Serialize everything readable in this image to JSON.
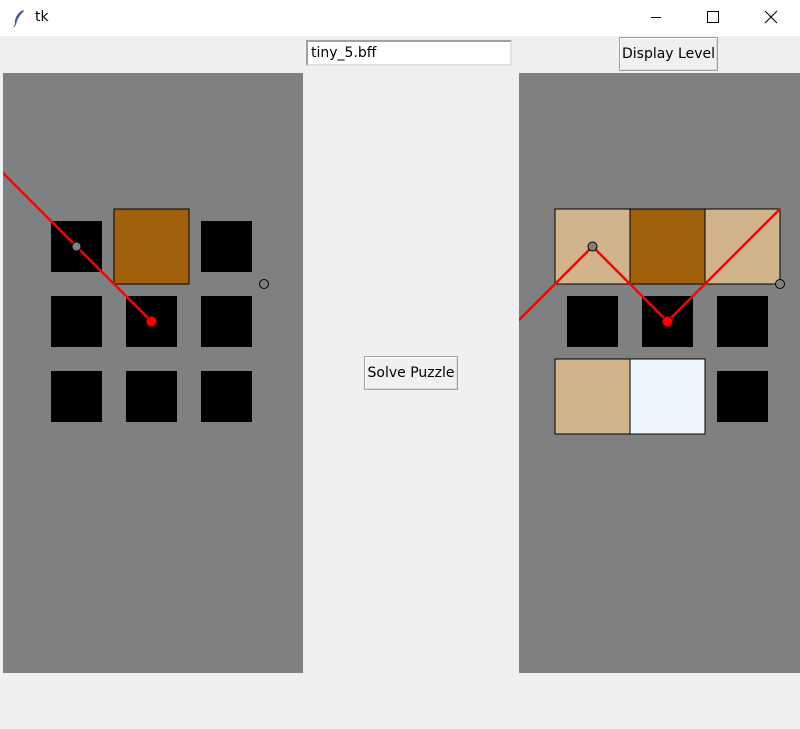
{
  "window": {
    "title": "tk",
    "icon": "feather-icon",
    "controls": [
      "minimize-icon",
      "maximize-icon",
      "close-icon"
    ]
  },
  "toolbar": {
    "filename_value": "tiny_5.bff",
    "display_level_label": "Display Level"
  },
  "main": {
    "solve_label": "Solve Puzzle"
  },
  "colors": {
    "canvas_bg": "#808080",
    "open_slot": "#000000",
    "opaque_block": "#a0600c",
    "reflect_block": "#d2b48c",
    "refract_block": "#eef4fb",
    "laser": "#ff0000",
    "target_hit": "#ff0000",
    "target_open": "#808080"
  },
  "puzzle_board": {
    "grid": [
      [
        "open",
        "opaque",
        "open"
      ],
      [
        "open",
        "open",
        "open"
      ],
      [
        "open",
        "open",
        "open"
      ]
    ],
    "lasers": [
      {
        "path": [
          [
            -1,
            -1
          ],
          [
            1,
            1
          ],
          [
            3,
            3
          ]
        ]
      }
    ],
    "targets": [
      {
        "point": [
          1,
          1
        ],
        "hit": false
      },
      {
        "point": [
          3,
          3
        ],
        "hit": true
      },
      {
        "point": [
          6,
          2
        ],
        "hit": false
      }
    ]
  },
  "solution_board": {
    "grid": [
      [
        "reflect",
        "opaque",
        "reflect"
      ],
      [
        "open",
        "open",
        "open"
      ],
      [
        "reflect",
        "refract",
        "open"
      ]
    ],
    "lasers": [
      {
        "path": [
          [
            -1,
            3
          ],
          [
            1,
            1
          ],
          [
            3,
            3
          ],
          [
            6,
            0
          ]
        ]
      }
    ],
    "targets": [
      {
        "point": [
          1,
          1
        ],
        "hit": false
      },
      {
        "point": [
          3,
          3
        ],
        "hit": true
      },
      {
        "point": [
          6,
          2
        ],
        "hit": false
      }
    ]
  }
}
